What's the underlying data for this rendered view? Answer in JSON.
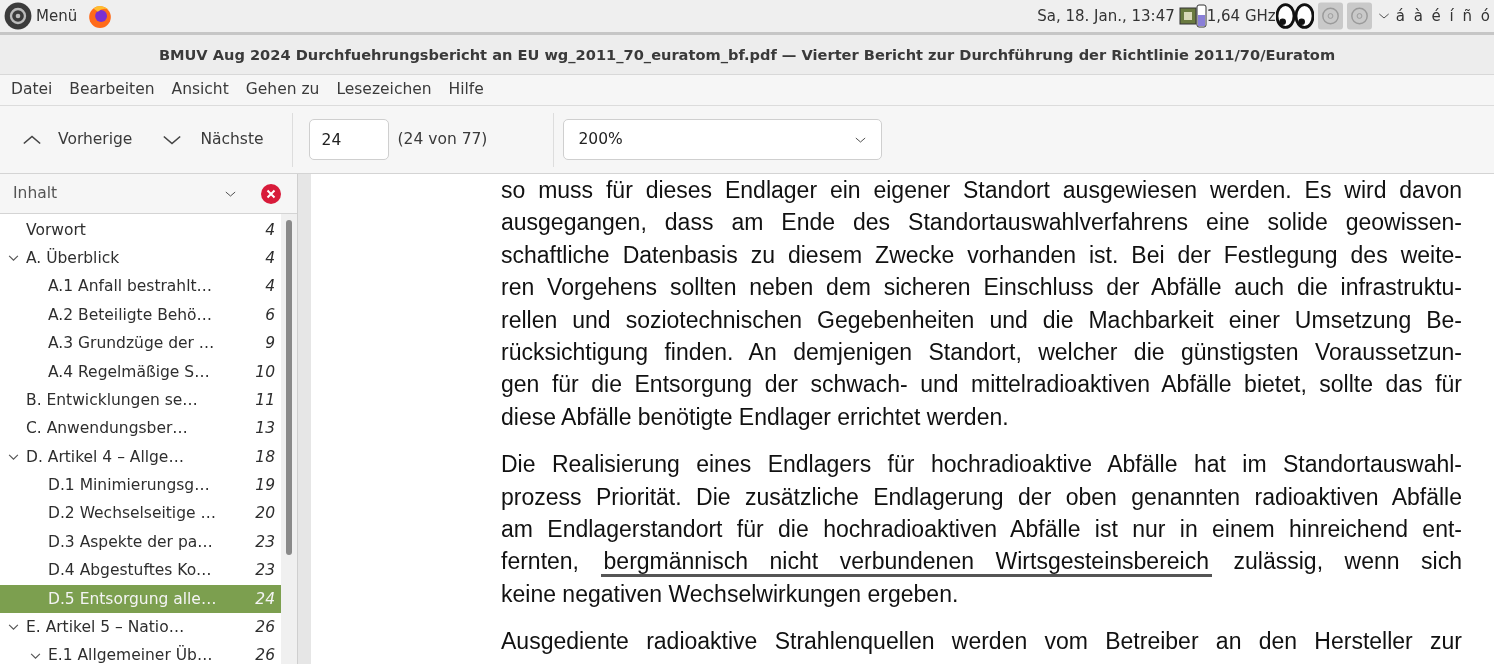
{
  "top_panel": {
    "menu_label": "Menü",
    "clock": "Sa, 18. Jan., 13:47",
    "cpu_freq": "1,64 GHz",
    "characters": "á à é í ñ ó"
  },
  "window": {
    "title": "BMUV Aug 2024 Durchfuehrungsbericht an EU wg_2011_70_euratom_bf.pdf — Vierter Bericht zur Durchführung der Richtlinie 2011/70/Euratom"
  },
  "menu": [
    "Datei",
    "Bearbeiten",
    "Ansicht",
    "Gehen zu",
    "Lesezeichen",
    "Hilfe"
  ],
  "toolbar": {
    "previous": "Vorherige",
    "next": "Nächste",
    "page": "24",
    "page_info": "(24 von 77)",
    "zoom": "200%"
  },
  "sidebar": {
    "title": "Inhalt",
    "items": [
      {
        "label": "Vorwort",
        "page": "4",
        "selected": false
      },
      {
        "label": "A. Überblick",
        "page": "4",
        "selected": false,
        "expanded": true,
        "children": [
          {
            "label": "A.1 Anfall bestrahlt…",
            "page": "4",
            "selected": false
          },
          {
            "label": "A.2 Beteiligte Behö…",
            "page": "6",
            "selected": false
          },
          {
            "label": "A.3 Grundzüge der …",
            "page": "9",
            "selected": false
          },
          {
            "label": "A.4 Regelmäßige S…",
            "page": "10",
            "selected": false
          }
        ]
      },
      {
        "label": "B. Entwicklungen se…",
        "page": "11",
        "selected": false
      },
      {
        "label": "C. Anwendungsber…",
        "page": "13",
        "selected": false
      },
      {
        "label": "D. Artikel 4 – Allge…",
        "page": "18",
        "selected": false,
        "expanded": true,
        "children": [
          {
            "label": "D.1 Minimierungsg…",
            "page": "19",
            "selected": false
          },
          {
            "label": "D.2 Wechselseitige …",
            "page": "20",
            "selected": false
          },
          {
            "label": "D.3 Aspekte der pa…",
            "page": "23",
            "selected": false
          },
          {
            "label": "D.4 Abgestuftes Ko…",
            "page": "23",
            "selected": false
          },
          {
            "label": "D.5 Entsorgung alle…",
            "page": "24",
            "selected": true
          }
        ]
      },
      {
        "label": "E. Artikel 5 – Natio…",
        "page": "26",
        "selected": false,
        "expanded": true,
        "children": [
          {
            "label": "E.1 Allgemeiner Üb…",
            "page": "26",
            "selected": false,
            "expanded": true
          }
        ]
      }
    ]
  },
  "document": {
    "paragraphs": [
      {
        "lines": [
          [
            {
              "text": "so muss für dieses Endlager ein eigener Standort ausgewiesen werden. Es wird davon"
            }
          ],
          [
            {
              "text": "ausgegangen, dass am Ende des Standortauswahlverfahrens eine solide geowissen-"
            }
          ],
          [
            {
              "text": "schaftliche Datenbasis zu diesem Zwecke vorhanden ist. Bei der Festlegung des weite-"
            }
          ],
          [
            {
              "text": "ren Vorgehens sollten neben dem sicheren Einschluss der Abfälle auch die infrastruktu-"
            }
          ],
          [
            {
              "text": "rellen und soziotechnischen Gegebenheiten und die Machbarkeit einer Umsetzung Be-"
            }
          ],
          [
            {
              "text": "rücksichtigung finden. An demjenigen Standort, welcher die günstigsten Voraussetzun-"
            }
          ],
          [
            {
              "text": "gen für die Entsorgung der schwach- und mittelradioaktiven Abfälle bietet, sollte das für"
            }
          ],
          [
            {
              "text": "diese Abfälle benötigte Endlager errichtet werden."
            }
          ]
        ]
      },
      {
        "lines": [
          [
            {
              "text": "Die Realisierung eines Endlagers für hochradioaktive Abfälle hat im Standortauswahl-"
            }
          ],
          [
            {
              "text": "prozess Priorität. Die zusätzliche Endlagerung der oben genannten radioaktiven Abfälle"
            }
          ],
          [
            {
              "text": "am Endlagerstandort für die hochradioaktiven Abfälle ist nur in einem hinreichend ent-"
            }
          ],
          [
            {
              "text": "fernten,"
            },
            {
              "text": "bergmännisch nicht verbundenen Wirtsgesteinsbereich",
              "underlined": true
            },
            {
              "text": "zulässig, wenn sich"
            }
          ],
          [
            {
              "text": "keine negativen Wechselwirkungen ergeben."
            }
          ]
        ]
      },
      {
        "lines": [
          [
            {
              "text": "Ausgediente radioaktive Strahlenquellen werden vom Betreiber an den Hersteller zur"
            }
          ]
        ]
      }
    ]
  }
}
